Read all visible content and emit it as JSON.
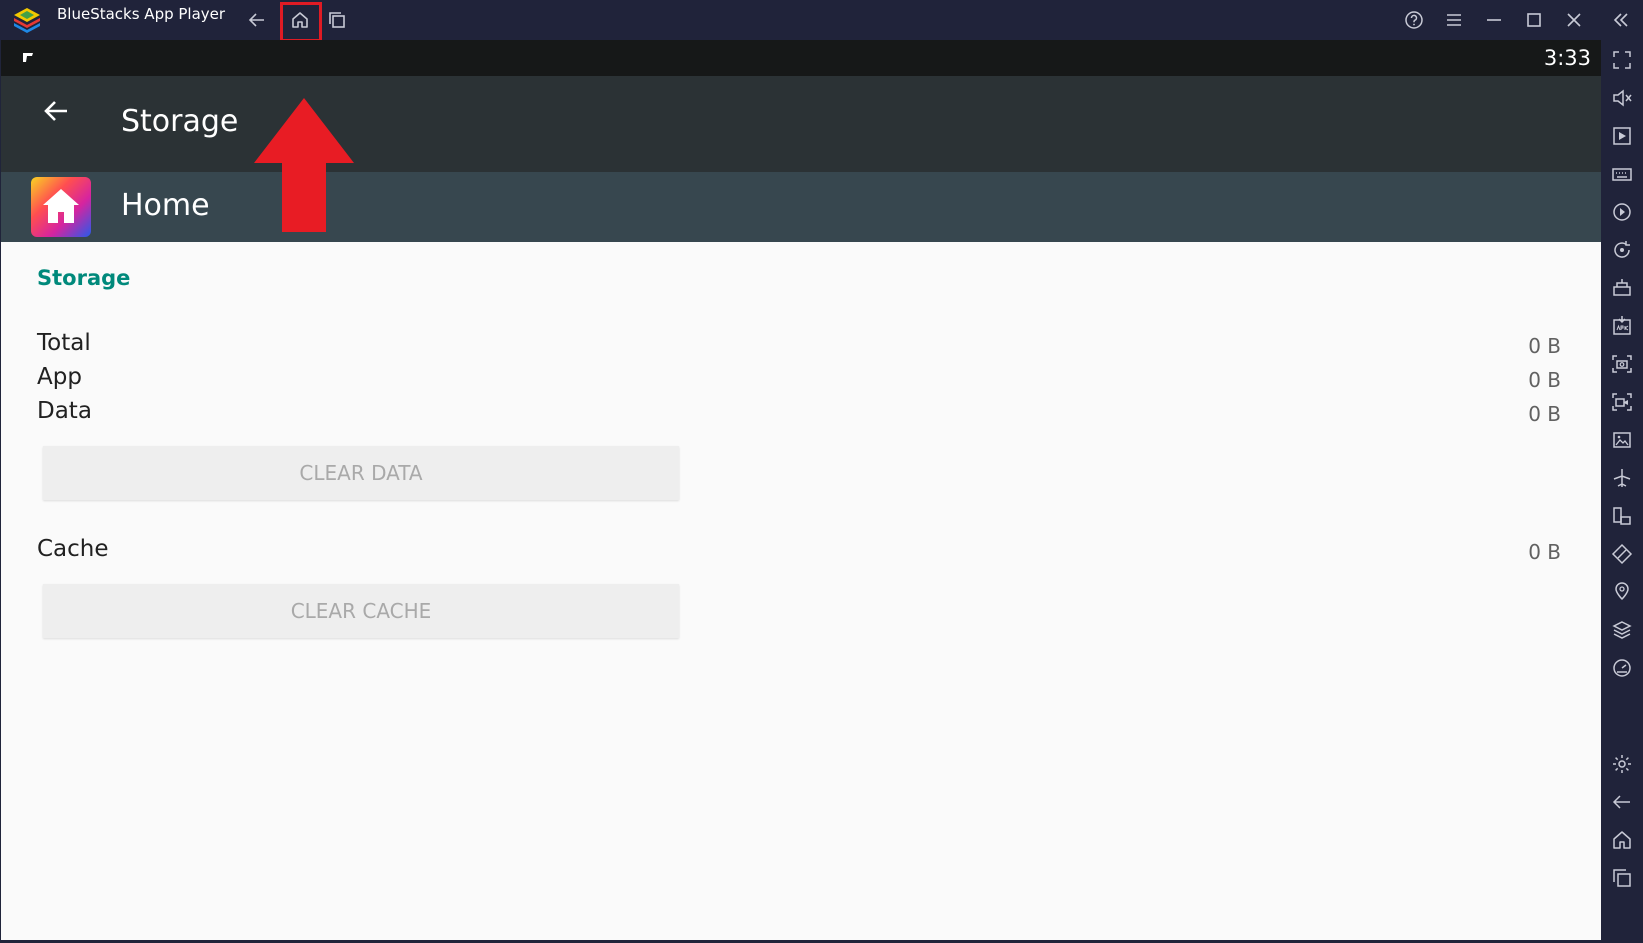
{
  "window": {
    "title": "BlueStacks App Player",
    "nav_buttons": [
      "back-icon",
      "home-icon",
      "recents-icon"
    ],
    "controls": [
      "help-icon",
      "menu-icon",
      "minimize-icon",
      "maximize-icon",
      "close-icon",
      "collapse-sidebar-icon"
    ]
  },
  "status_bar": {
    "time": "3:33"
  },
  "toolbar": {
    "title": "Storage"
  },
  "app_header": {
    "name": "Home"
  },
  "storage": {
    "section_title": "Storage",
    "rows": [
      {
        "label": "Total",
        "value": "0 B"
      },
      {
        "label": "App",
        "value": "0 B"
      },
      {
        "label": "Data",
        "value": "0 B"
      }
    ],
    "clear_data_label": "CLEAR DATA",
    "cache_label": "Cache",
    "cache_value": "0 B",
    "clear_cache_label": "CLEAR CACHE"
  },
  "sidebar": {
    "icons": [
      "fullscreen-icon",
      "volume-icon",
      "play-store-icon",
      "keyboard-icon",
      "macro-icon",
      "rotate-icon",
      "build-icon",
      "apk-icon",
      "screenshot-icon",
      "record-icon",
      "media-folder-icon",
      "airplane-icon",
      "multi-instance-icon",
      "eco-mode-icon",
      "location-icon",
      "layers-icon",
      "performance-icon",
      "settings-icon",
      "back-icon",
      "home-icon",
      "recents-icon"
    ]
  },
  "colors": {
    "accent": "#00897b",
    "highlight": "#e01b24",
    "titlebar": "#20233a"
  }
}
